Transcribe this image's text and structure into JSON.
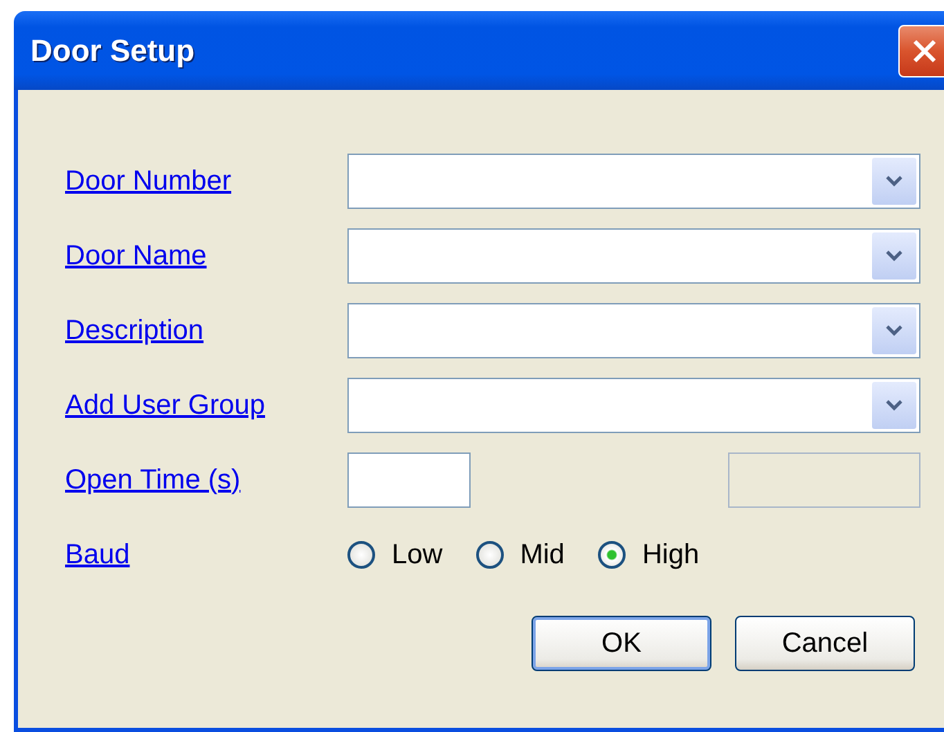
{
  "window": {
    "title": "Door Setup"
  },
  "fields": [
    {
      "label": "Door Number",
      "kind": "combo"
    },
    {
      "label": "Door Name",
      "kind": "combo"
    },
    {
      "label": "Description",
      "kind": "combo"
    },
    {
      "label": "Add User Group",
      "kind": "combo"
    },
    {
      "label": "Open Time (s)",
      "kind": "pair",
      "extra_disabled": true
    }
  ],
  "baud": {
    "label": "Baud",
    "options": [
      {
        "label": "Low",
        "selected": false
      },
      {
        "label": "Mid",
        "selected": false
      },
      {
        "label": "High",
        "selected": true
      }
    ]
  },
  "buttons": [
    {
      "label": "OK",
      "default": true
    },
    {
      "label": "Cancel",
      "default": false
    }
  ]
}
